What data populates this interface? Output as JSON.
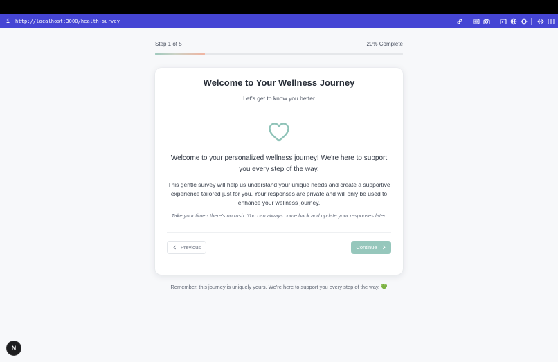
{
  "browser": {
    "info_glyph": "i",
    "url": "http://localhost:3000/health-survey",
    "tool_icons": [
      "link-icon",
      "screenshot-icon",
      "camera-icon",
      "terminal-icon",
      "globe-icon",
      "crosshair-icon",
      "code-icon",
      "sidebar-icon"
    ]
  },
  "progress": {
    "step_label": "Step 1 of 5",
    "complete_label": "20% Complete",
    "value_percent": 20
  },
  "card": {
    "title": "Welcome to Your Wellness Journey",
    "subtitle": "Let's get to know you better",
    "icon": "heart-icon",
    "intro": "Welcome to your personalized wellness journey! We're here to support you every step of the way.",
    "body": "This gentle survey will help us understand your unique needs and create a supportive experience tailored just for you. Your responses are private and will only be used to enhance your wellness journey.",
    "note": "Take your time - there's no rush. You can always come back and update your responses later.",
    "prev_label": "Previous",
    "next_label": "Continue"
  },
  "footer": {
    "text": "Remember, this journey is uniquely yours. We're here to support you every step of the way.",
    "emoji": "💚"
  },
  "dev_badge": "N",
  "colors": {
    "urlbar": "#4545d4",
    "accent": "#96c7bc",
    "heart_stroke": "#8fc3b8"
  }
}
